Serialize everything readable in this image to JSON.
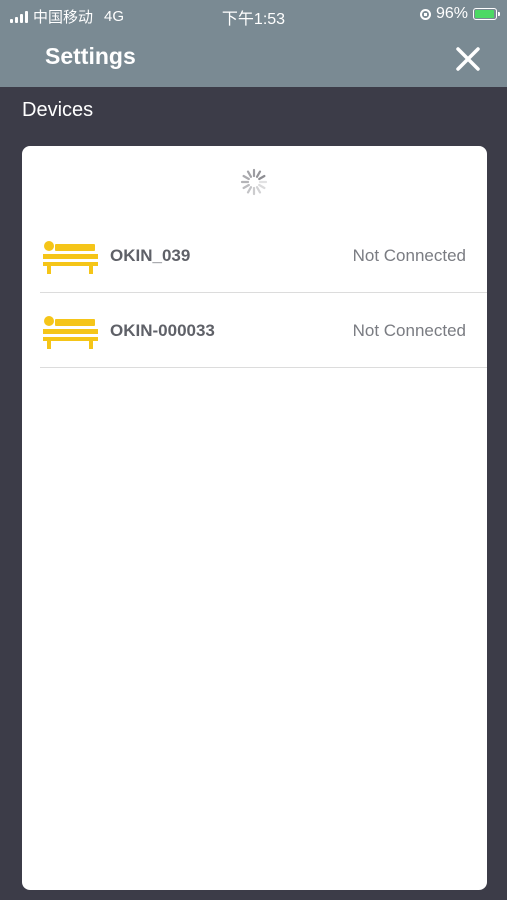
{
  "status_bar": {
    "carrier": "中国移动",
    "network": "4G",
    "time": "下午1:53",
    "battery_percent": "96%",
    "battery_level": 0.96
  },
  "header": {
    "title": "Settings",
    "close_icon": "close-icon"
  },
  "section": {
    "label": "Devices"
  },
  "devices": [
    {
      "name": "OKIN_039",
      "status": "Not Connected",
      "icon": "bed-icon"
    },
    {
      "name": "OKIN-000033",
      "status": "Not Connected",
      "icon": "bed-icon"
    }
  ],
  "colors": {
    "header_bg": "#7a8a93",
    "page_bg": "#3c3c48",
    "accent_yellow": "#f5c518",
    "battery_green": "#4cd964"
  }
}
